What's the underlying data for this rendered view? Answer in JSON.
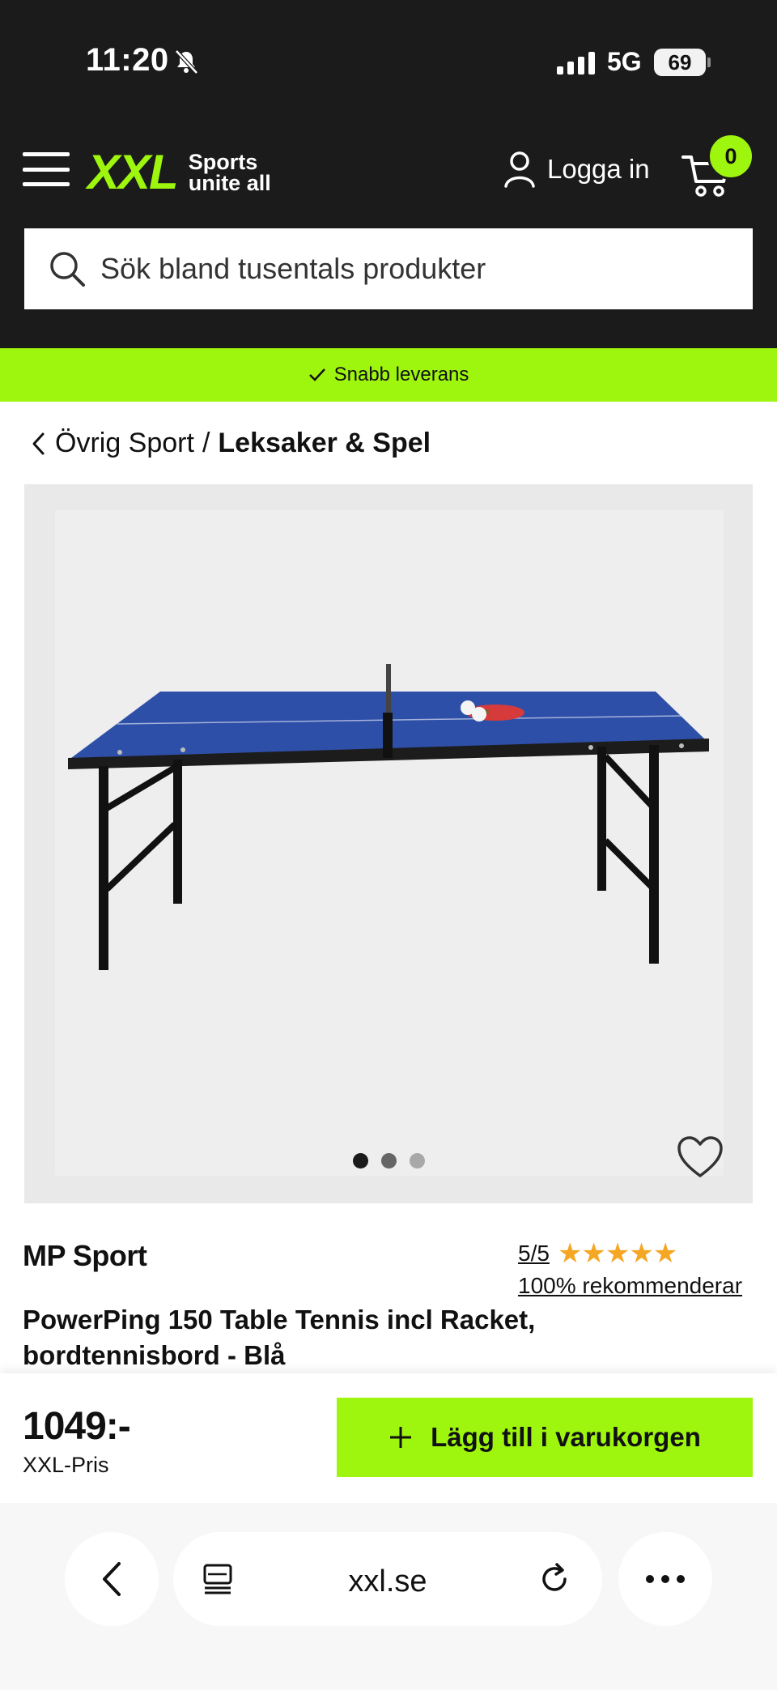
{
  "status_bar": {
    "time": "11:20",
    "network": "5G",
    "battery": "69"
  },
  "header": {
    "logo_text": "XXL",
    "tagline_line1": "Sports",
    "tagline_line2": "unite all",
    "login_label": "Logga in",
    "cart_count": "0"
  },
  "search": {
    "placeholder": "Sök bland tusentals produkter"
  },
  "banner": {
    "text": "Snabb leverans"
  },
  "breadcrumb": {
    "parent": "Övrig Sport",
    "separator": "/",
    "current": "Leksaker & Spel"
  },
  "gallery": {
    "image_count": 3,
    "active_index": 0
  },
  "product": {
    "brand": "MP Sport",
    "rating_score": "5/5",
    "stars": "★★★★★",
    "recommend_text": "100% rekommenderar",
    "title": "PowerPing 150 Table Tennis incl Racket, bordtennisbord - Blå"
  },
  "purchase": {
    "price": "1049:-",
    "price_label": "XXL-Pris",
    "add_to_cart_label": "Lägg till i varukorgen"
  },
  "browser": {
    "url": "xxl.se"
  },
  "colors": {
    "accent": "#9ef50e",
    "header_bg": "#1b1b1b",
    "star": "#f5a623",
    "table_blue": "#2e4fa8"
  }
}
